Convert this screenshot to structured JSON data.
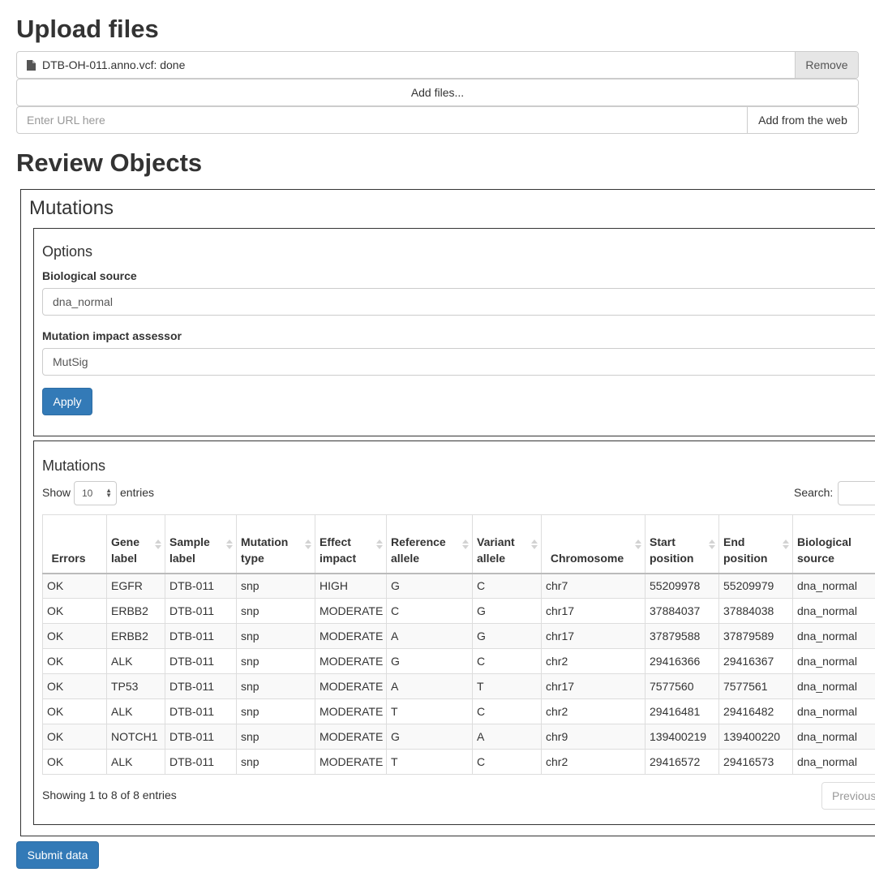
{
  "upload": {
    "title": "Upload files",
    "file": {
      "name": "DTB-OH-011.anno.vcf: done",
      "icon": "file-icon",
      "remove_label": "Remove"
    },
    "add_files_label": "Add files...",
    "url_placeholder": "Enter URL here",
    "add_web_label": "Add from the web"
  },
  "review": {
    "title": "Review Objects",
    "section_title": "Mutations",
    "options": {
      "title": "Options",
      "biological_source": {
        "label": "Biological source",
        "value": "dna_normal"
      },
      "impact_assessor": {
        "label": "Mutation impact assessor",
        "value": "MutSig"
      },
      "apply_label": "Apply"
    },
    "table": {
      "title": "Mutations",
      "show_label": "Show",
      "page_size": "10",
      "entries_label": "entries",
      "search_label": "Search:",
      "columns": [
        [
          "Errors"
        ],
        [
          "Gene",
          "label"
        ],
        [
          "Sample",
          "label"
        ],
        [
          "Mutation",
          "type"
        ],
        [
          "Effect",
          "impact"
        ],
        [
          "Reference",
          "allele"
        ],
        [
          "Variant",
          "allele"
        ],
        [
          "Chromosome"
        ],
        [
          "Start",
          "position"
        ],
        [
          "End",
          "position"
        ],
        [
          "Biological",
          "source"
        ]
      ],
      "rows": [
        [
          "OK",
          "EGFR",
          "DTB-011",
          "snp",
          "HIGH",
          "G",
          "C",
          "chr7",
          "55209978",
          "55209979",
          "dna_normal"
        ],
        [
          "OK",
          "ERBB2",
          "DTB-011",
          "snp",
          "MODERATE",
          "C",
          "G",
          "chr17",
          "37884037",
          "37884038",
          "dna_normal"
        ],
        [
          "OK",
          "ERBB2",
          "DTB-011",
          "snp",
          "MODERATE",
          "A",
          "G",
          "chr17",
          "37879588",
          "37879589",
          "dna_normal"
        ],
        [
          "OK",
          "ALK",
          "DTB-011",
          "snp",
          "MODERATE",
          "G",
          "C",
          "chr2",
          "29416366",
          "29416367",
          "dna_normal"
        ],
        [
          "OK",
          "TP53",
          "DTB-011",
          "snp",
          "MODERATE",
          "A",
          "T",
          "chr17",
          "7577560",
          "7577561",
          "dna_normal"
        ],
        [
          "OK",
          "ALK",
          "DTB-011",
          "snp",
          "MODERATE",
          "T",
          "C",
          "chr2",
          "29416481",
          "29416482",
          "dna_normal"
        ],
        [
          "OK",
          "NOTCH1",
          "DTB-011",
          "snp",
          "MODERATE",
          "G",
          "A",
          "chr9",
          "139400219",
          "139400220",
          "dna_normal"
        ],
        [
          "OK",
          "ALK",
          "DTB-011",
          "snp",
          "MODERATE",
          "T",
          "C",
          "chr2",
          "29416572",
          "29416573",
          "dna_normal"
        ]
      ],
      "info": "Showing 1 to 8 of 8 entries",
      "previous_label": "Previous"
    },
    "submit_label": "Submit data"
  },
  "colors": {
    "primary": "#337ab7",
    "border": "#cccccc",
    "stripe": "#f9f9f9",
    "remove_bg": "#e6e6e6"
  }
}
